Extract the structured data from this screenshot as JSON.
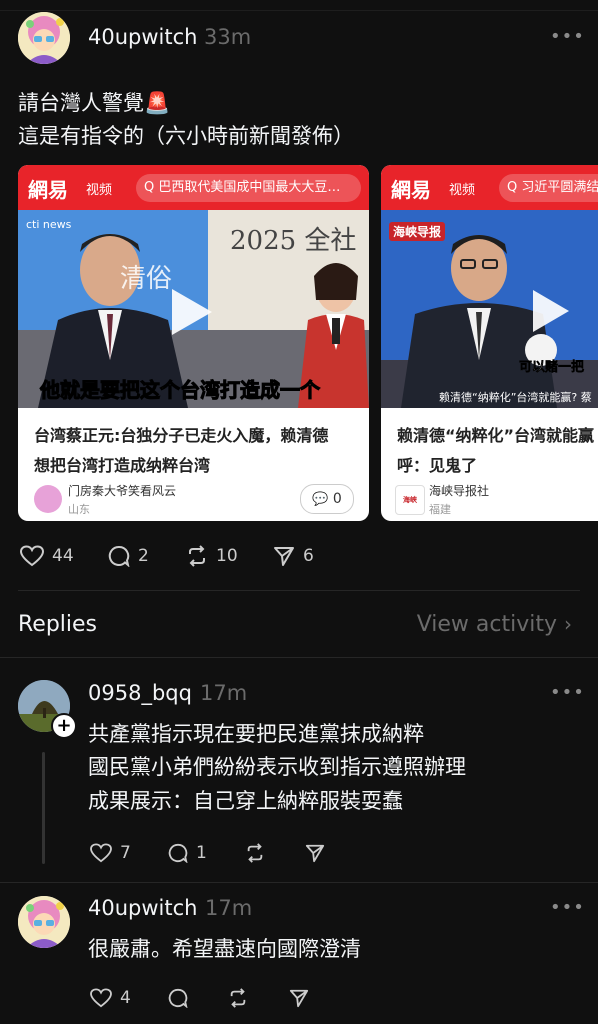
{
  "post": {
    "username": "40upwitch",
    "time": "33m",
    "text_line1": "請台灣人警覺🚨",
    "text_line2": "這是有指令的（六小時前新聞發佈）",
    "cards": [
      {
        "site_logo": "網易",
        "site_tab": "视频",
        "search_text": "Q 巴西取代美国成中国最大大豆…",
        "thumb_caption": "他就是要把这个台湾打造成一个",
        "thumb_year": "2025 全社",
        "thumb_name": "清俗",
        "thumb_channel": "cti news",
        "title_line1": "台湾蔡正元:台独分子已走火入魔，赖清德",
        "title_line2": "想把台湾打造成纳粹台湾",
        "source_name": "门房秦大爷笑看风云",
        "source_location": "山东",
        "comment_count": "0"
      },
      {
        "site_logo": "網易",
        "site_tab": "视频",
        "search_text": "Q 习近平圆满结束",
        "thumb_caption": "赖清德“纳粹化”台湾就能赢?  蔡",
        "thumb_bubble": "可以赌一把",
        "thumb_brand": "海峡导报",
        "title_line1": "赖清德“纳粹化”台湾就能赢",
        "title_line2": "呼：见鬼了",
        "source_name": "海峡导报社",
        "source_location": "福建"
      }
    ],
    "actions": {
      "likes": "44",
      "comments": "2",
      "reposts": "10",
      "shares": "6"
    }
  },
  "replies_header": {
    "title": "Replies",
    "view_activity": "View activity"
  },
  "replies": [
    {
      "username": "0958_bqq",
      "time": "17m",
      "lines": [
        "共產黨指示現在要把民進黨抹成納粹",
        "國民黨小弟們紛紛表示收到指示遵照辦理",
        "成果展示：自己穿上納粹服裝耍蠢"
      ],
      "likes": "7",
      "comments": "1"
    },
    {
      "username": "40upwitch",
      "time": "17m",
      "lines": [
        "很嚴肅。希望盡速向國際澄清"
      ],
      "likes": "4"
    }
  ],
  "colors": {
    "background": "#101010",
    "netease_red": "#e8242a",
    "muted": "#6b6b6b"
  },
  "icons": [
    "more-icon",
    "heart-icon",
    "comment-icon",
    "repost-icon",
    "share-icon",
    "play-icon",
    "search-icon",
    "chevron-right-icon"
  ]
}
